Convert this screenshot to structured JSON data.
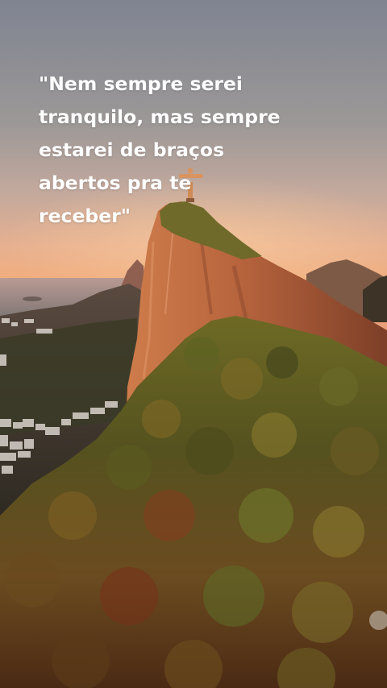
{
  "quote": {
    "text": "\"Nem sempre serei\ntranquilo, mas sempre\nestarei de braços\nabertos pra te\nreceber\""
  },
  "colors": {
    "sky_top": "#7f8491",
    "sky_mid": "#c3a99d",
    "sky_horizon": "#f4ad7a",
    "rock": "#b7643d",
    "forest_dark": "#3b3a1a",
    "forest_light": "#8a6a2a",
    "text": "#ffffff"
  }
}
